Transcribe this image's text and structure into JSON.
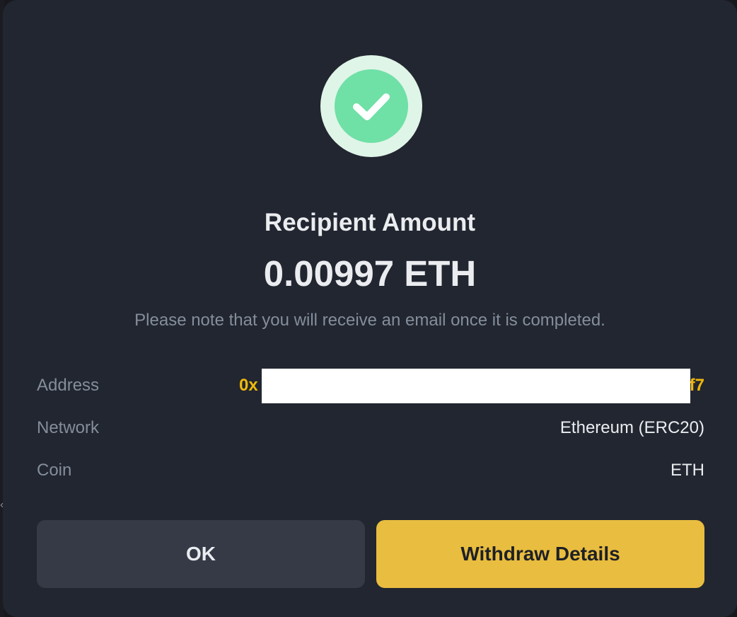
{
  "modal": {
    "status_icon": "check-icon",
    "title": "Recipient Amount",
    "amount": "0.00997 ETH",
    "note": "Please note that you will receive an email once it is completed."
  },
  "details": {
    "address": {
      "label": "Address",
      "value_prefix": "0x",
      "value_suffix": "f7"
    },
    "network": {
      "label": "Network",
      "value": "Ethereum (ERC20)"
    },
    "coin": {
      "label": "Coin",
      "value": "ETH"
    }
  },
  "actions": {
    "ok_label": "OK",
    "details_label": "Withdraw Details"
  },
  "colors": {
    "modal_bg": "#222630",
    "accent": "#e9bd3f",
    "address_text": "#f0b90b",
    "success": "#6fe0a6",
    "success_ring": "#dff5e8"
  }
}
